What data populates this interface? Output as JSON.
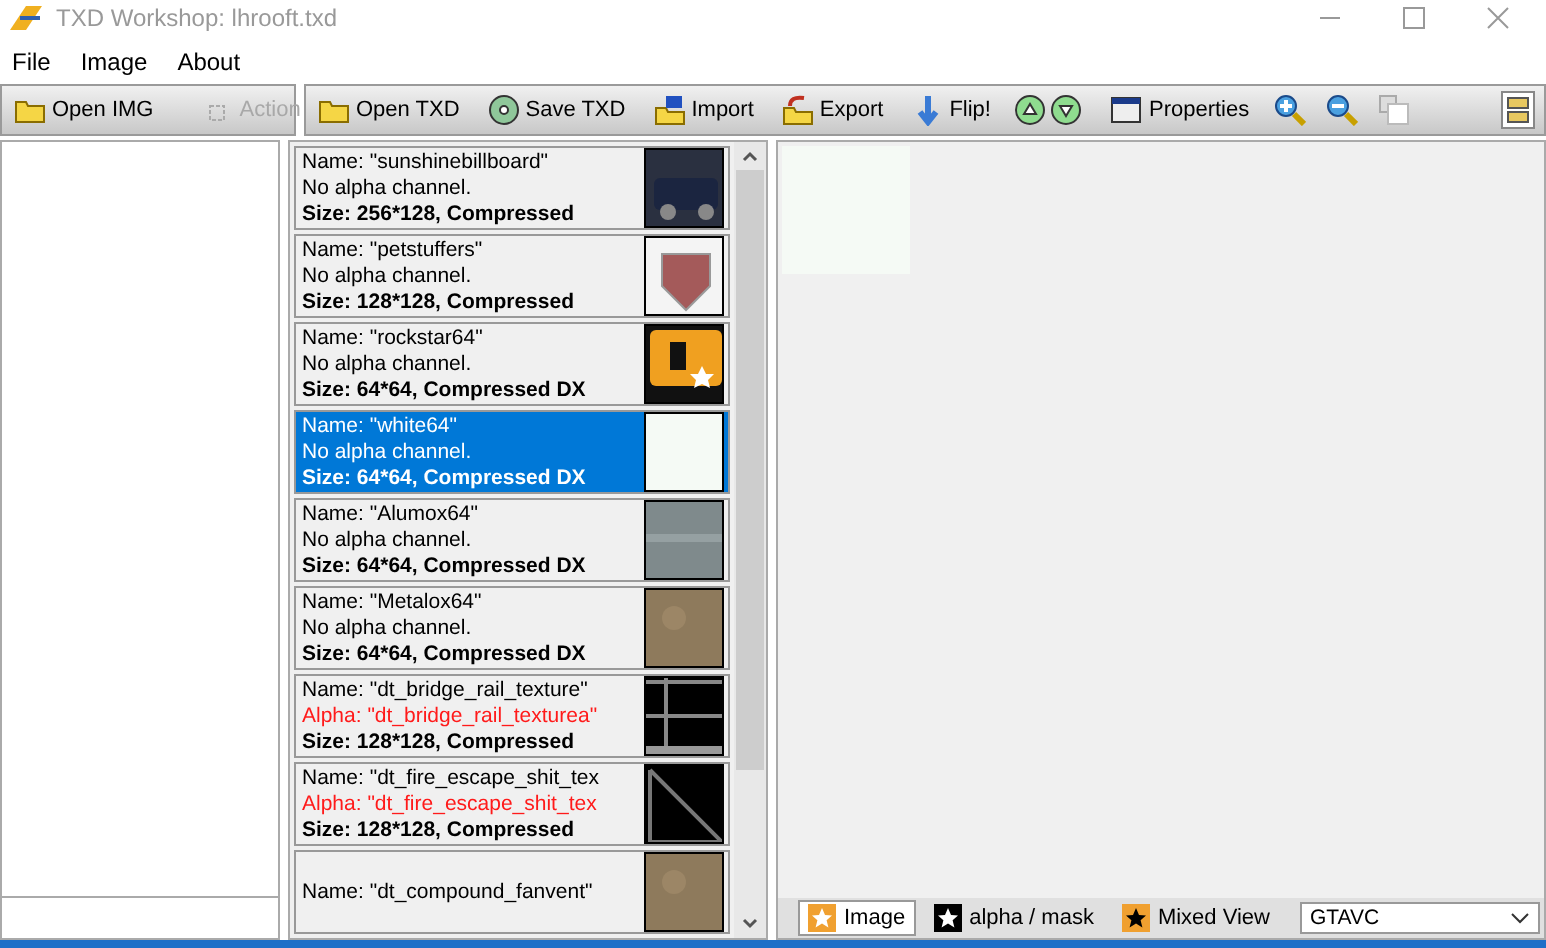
{
  "window": {
    "title": "TXD Workshop: lhrooft.txd"
  },
  "menu": [
    "File",
    "Image",
    "About"
  ],
  "img_toolbar": [
    {
      "label": "Open IMG",
      "kind": "folder",
      "disabled": false
    },
    {
      "label": "Action",
      "kind": "action",
      "disabled": true
    }
  ],
  "txd_toolbar": [
    {
      "label": "Open TXD",
      "kind": "folder"
    },
    {
      "label": "Save TXD",
      "kind": "disc"
    },
    {
      "label": "Import",
      "kind": "import"
    },
    {
      "label": "Export",
      "kind": "export"
    },
    {
      "label": "Flip!",
      "kind": "flip"
    },
    {
      "kind": "updown"
    },
    {
      "label": "Properties",
      "kind": "properties"
    },
    {
      "kind": "zoomin"
    },
    {
      "kind": "zoomout"
    },
    {
      "kind": "copy"
    }
  ],
  "textures": [
    {
      "name": "Name: \"sunshinebillboard\"",
      "alpha": {
        "kind": "none",
        "text": "No alpha channel."
      },
      "size": "Size: 256*128, Compressed",
      "kind": "photo",
      "selected": false
    },
    {
      "name": "Name: \"petstuffers\"",
      "alpha": {
        "kind": "none",
        "text": "No alpha channel."
      },
      "size": "Size: 128*128, Compressed",
      "kind": "emblem",
      "selected": false
    },
    {
      "name": "Name: \"rockstar64\"",
      "alpha": {
        "kind": "none",
        "text": "No alpha channel."
      },
      "size": "Size: 64*64, Compressed DX",
      "kind": "logo",
      "selected": false
    },
    {
      "name": "Name: \"white64\"",
      "alpha": {
        "kind": "none",
        "text": "No alpha channel."
      },
      "size": "Size: 64*64, Compressed DX",
      "kind": "blank",
      "selected": true
    },
    {
      "name": "Name: \"Alumox64\"",
      "alpha": {
        "kind": "none",
        "text": "No alpha channel."
      },
      "size": "Size: 64*64, Compressed DX",
      "kind": "metal",
      "selected": false
    },
    {
      "name": "Name: \"Metalox64\"",
      "alpha": {
        "kind": "none",
        "text": "No alpha channel."
      },
      "size": "Size: 64*64, Compressed DX",
      "kind": "rust",
      "selected": false
    },
    {
      "name": "Name: \"dt_bridge_rail_texture\"",
      "alpha": {
        "kind": "alpha",
        "text": "Alpha: \"dt_bridge_rail_texturea\""
      },
      "size": "Size: 128*128, Compressed",
      "kind": "rails",
      "selected": false
    },
    {
      "name": "Name: \"dt_fire_escape_shit_tex",
      "alpha": {
        "kind": "alpha",
        "text": "Alpha: \"dt_fire_escape_shit_tex"
      },
      "size": "Size: 128*128, Compressed",
      "kind": "diagonal",
      "selected": false
    },
    {
      "name": "Name: \"dt_compound_fanvent\"",
      "kind": "rust",
      "selected": false
    }
  ],
  "view_tabs": [
    {
      "label": "Image",
      "selected": true,
      "kind": "image"
    },
    {
      "label": "alpha / mask",
      "selected": false,
      "kind": "alpha"
    },
    {
      "label": "Mixed View",
      "selected": false,
      "kind": "mixed"
    }
  ],
  "game": {
    "value": "GTAVC"
  }
}
